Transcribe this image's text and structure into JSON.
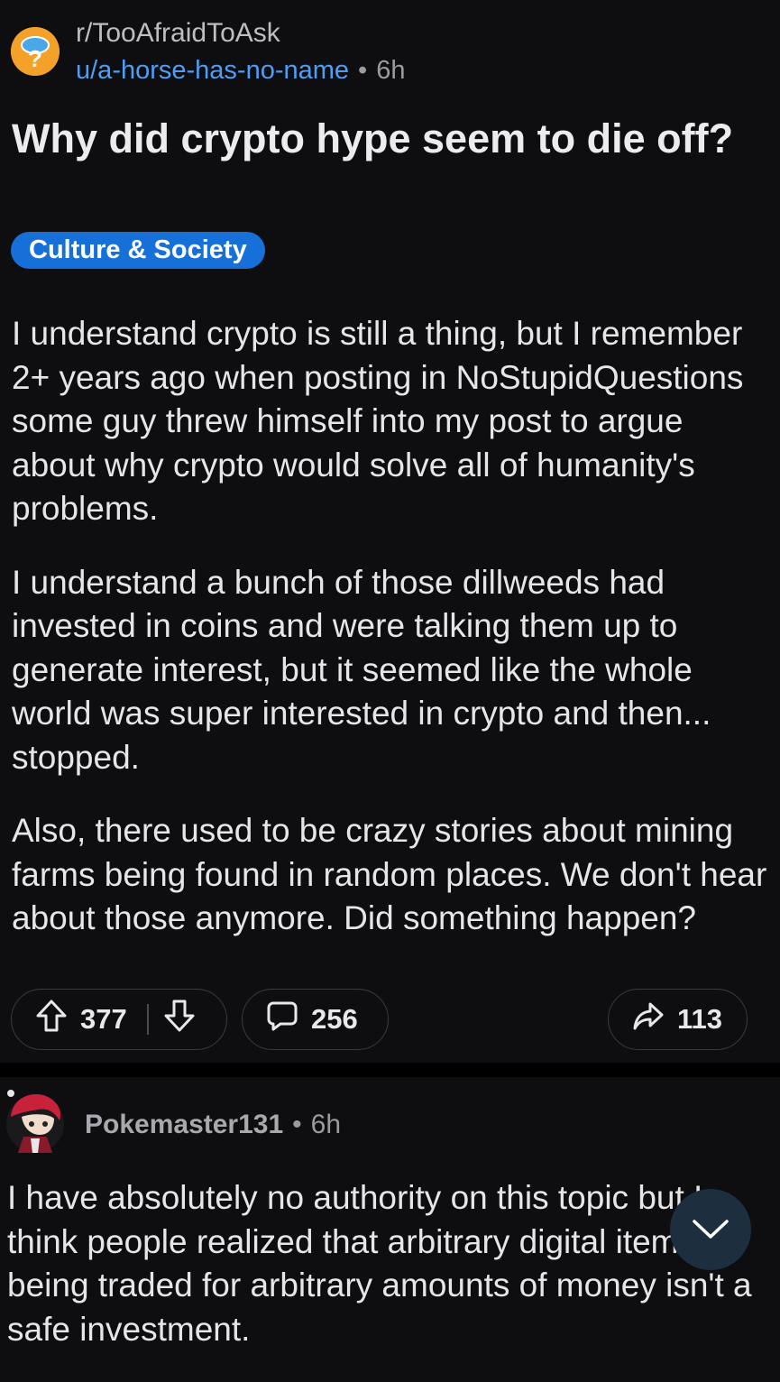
{
  "post": {
    "subreddit": "r/TooAfraidToAsk",
    "author": "u/a-horse-has-no-name",
    "separator": "•",
    "age": "6h",
    "title": "Why did crypto hype seem to die off?",
    "flair": "Culture & Society",
    "body": [
      "I understand crypto is still a thing, but I remember 2+ years ago when posting in NoStupidQuestions some guy threw himself into my post to argue about why crypto would solve all of humanity's problems.",
      "I understand a bunch of those dillweeds had invested in coins and were talking them up to generate interest, but it seemed like the whole world was super interested in crypto and then... stopped.",
      "Also, there used to be crazy stories about mining farms being found in random places. We don't hear about those anymore. Did something happen?"
    ],
    "upvotes": "377",
    "comments": "256",
    "shares": "113"
  },
  "comment": {
    "author": "Pokemaster131",
    "separator": "•",
    "age": "6h",
    "body": "I have absolutely no authority on this topic but I think people realized that arbitrary digital items being traded for arbitrary amounts of money isn't a safe investment."
  },
  "icons": {
    "subreddit_avatar": "question-mark-avatar-icon",
    "upvote": "arrow-up-icon",
    "downvote": "arrow-down-icon",
    "comment": "speech-bubble-icon",
    "share": "share-arrow-icon",
    "collapse": "chevron-down-icon"
  },
  "colors": {
    "background": "#0e0e10",
    "accent_link": "#4f9ef6",
    "flair_bg": "#1670d8",
    "subreddit_avatar": "#f4a12a"
  }
}
